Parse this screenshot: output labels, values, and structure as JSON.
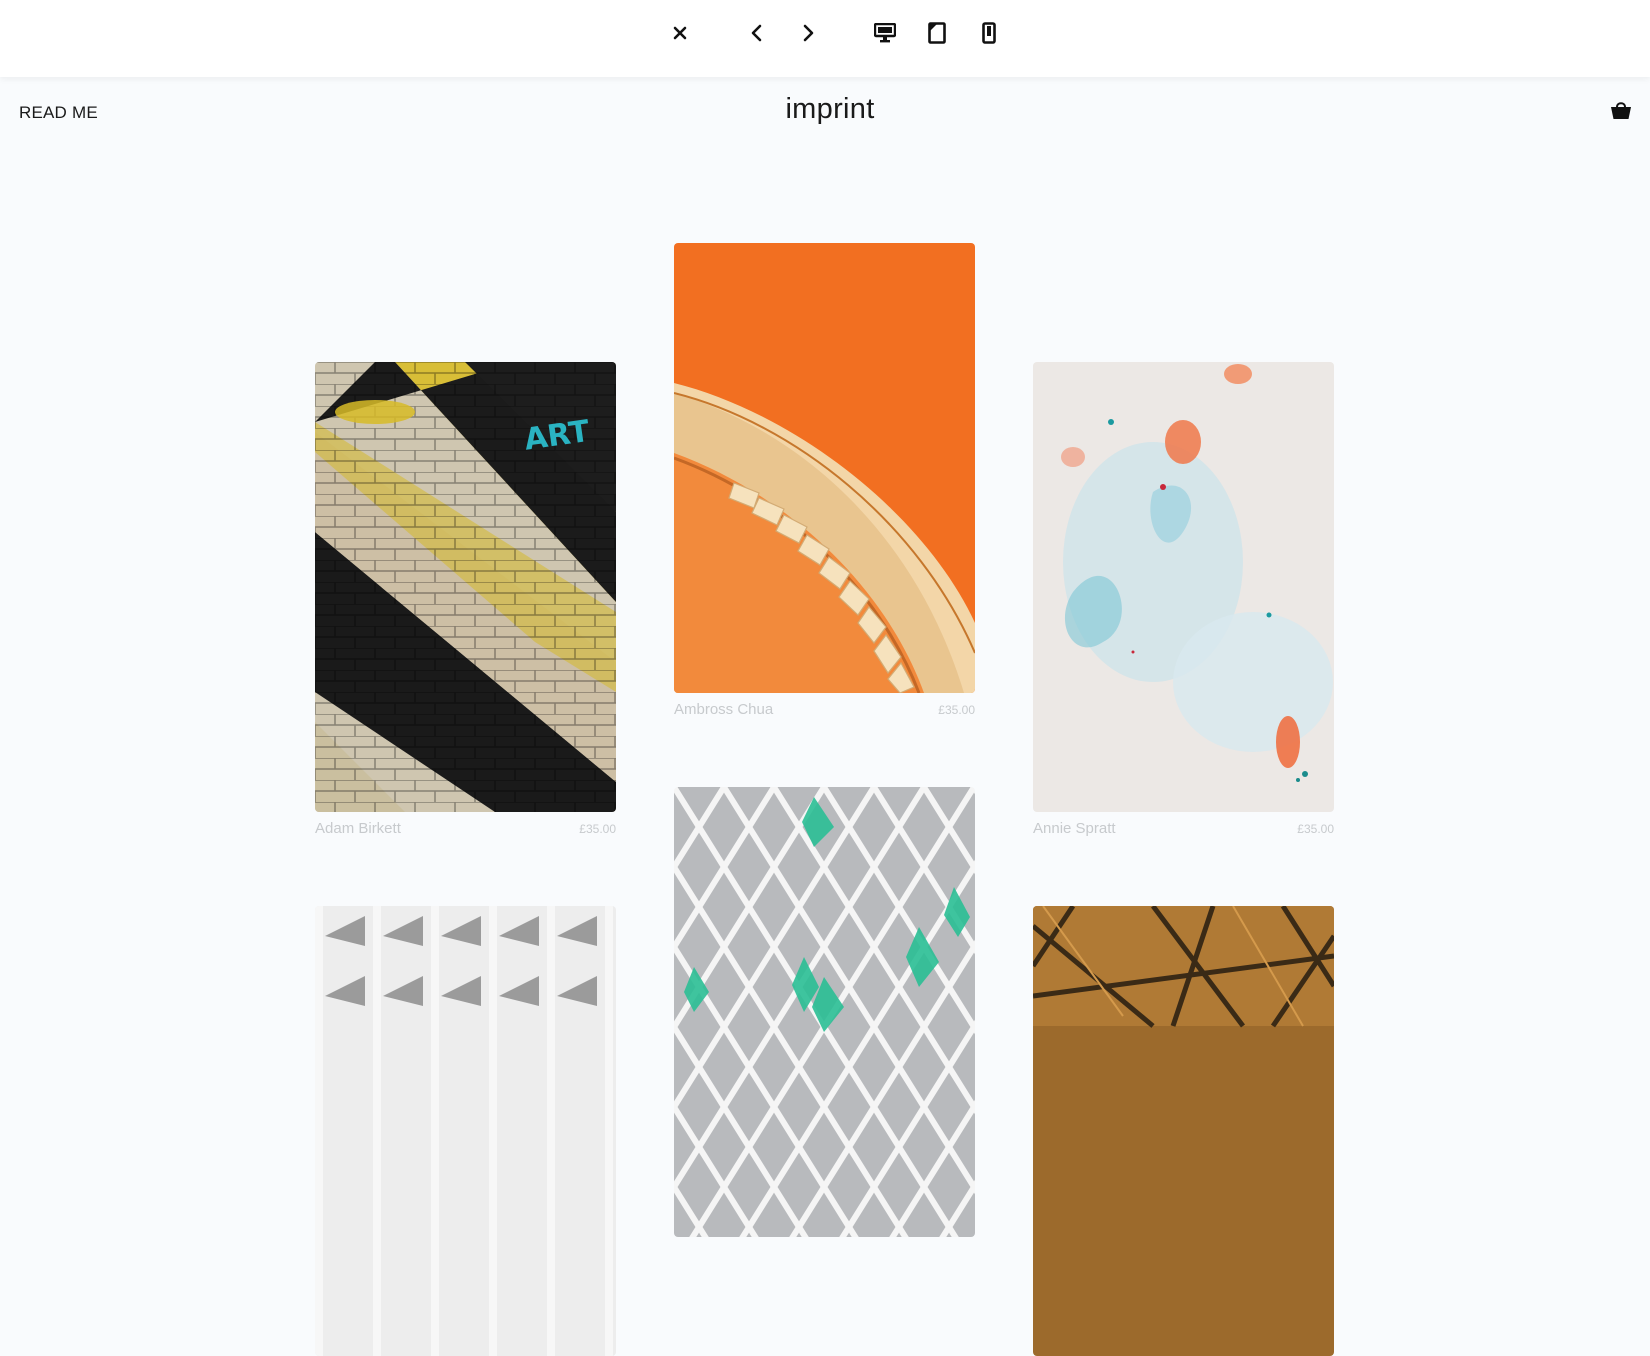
{
  "preview_bar": {
    "buttons": [
      {
        "name": "close-icon"
      },
      {
        "name": "chevron-left-icon"
      },
      {
        "name": "chevron-right-icon"
      },
      {
        "name": "desktop-icon"
      },
      {
        "name": "tablet-icon"
      },
      {
        "name": "mobile-icon"
      }
    ]
  },
  "header": {
    "readme_label": "READ ME",
    "logo_text": "imprint",
    "cart_icon": "shopping-bag-icon"
  },
  "products": [
    {
      "artist": "Adam Birkett",
      "price": "£35.00",
      "image": "yellow-black-striped-brick-wall"
    },
    {
      "artist": "Ambross Chua",
      "price": "£35.00",
      "image": "orange-spiral-staircase"
    },
    {
      "artist": "Annie Spratt",
      "price": "£35.00",
      "image": "pastel-watercolor-marble"
    },
    {
      "artist": "",
      "price": "",
      "image": "white-geometric-facade"
    },
    {
      "artist": "",
      "price": "",
      "image": "green-diamond-lattice"
    },
    {
      "artist": "",
      "price": "",
      "image": "amber-steel-roof-lattice"
    }
  ],
  "colors": {
    "page_bg": "#f9fbfd",
    "caption": "#c7cacd",
    "text": "#1a1a1a"
  }
}
